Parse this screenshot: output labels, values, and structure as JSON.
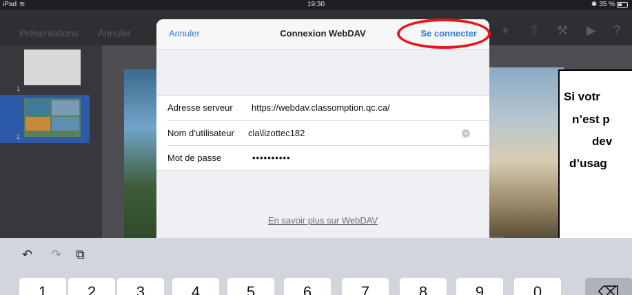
{
  "status_bar": {
    "device": "iPad",
    "time": "19:30",
    "battery": "35 %"
  },
  "toolbar": {
    "presentations": "Présentations",
    "cancel": "Annuler",
    "icons": [
      "add-icon",
      "share-icon",
      "wrench-icon",
      "play-icon",
      "help-icon"
    ]
  },
  "navigator": {
    "slides": [
      {
        "number": "1"
      },
      {
        "number": "2"
      }
    ]
  },
  "dialog": {
    "cancel": "Annuler",
    "title": "Connexion WebDAV",
    "connect": "Se connecter",
    "fields": [
      {
        "label": "Adresse serveur",
        "value": "https://webdav.classomption.qc.ca/"
      },
      {
        "label": "Nom d’utilisateur",
        "value": "cla\\lizottec182"
      },
      {
        "label": "Mot de passe",
        "value": "••••••••••"
      }
    ],
    "learn_more": "En savoir plus sur WebDAV"
  },
  "callout": {
    "lines": [
      "Si votr",
      "n’est p",
      "dev",
      "d’usag"
    ]
  },
  "keyboard": {
    "tools": {
      "undo": "↶",
      "redo": "↷",
      "paste": "⧉"
    },
    "keys": [
      "1",
      "2",
      "3",
      "4",
      "5",
      "6",
      "7",
      "8",
      "9",
      "0"
    ],
    "delete": "⌫"
  },
  "colors": {
    "accent": "#2f7bdc",
    "highlight": "#e8151b",
    "selection": "#2c5aa8"
  }
}
